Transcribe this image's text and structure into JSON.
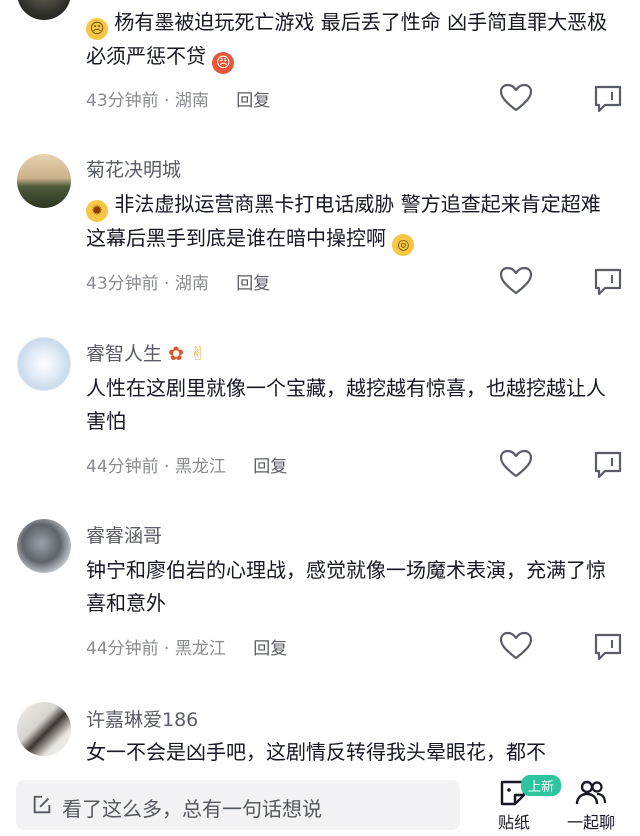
{
  "comments": [
    {
      "name": "",
      "text": "杨有墨被迫玩死亡游戏 最后丢了性命 凶手简直罪大恶极 必须严惩不贷",
      "time": "43分钟前",
      "location": "湖南",
      "reply_label": "回复"
    },
    {
      "name": "菊花决明城",
      "text": "非法虚拟运营商黑卡打电话威胁 警方追查起来肯定超难 这幕后黑手到底是谁在暗中操控啊",
      "time": "43分钟前",
      "location": "湖南",
      "reply_label": "回复"
    },
    {
      "name": "睿智人生",
      "text": "人性在这剧里就像一个宝藏，越挖越有惊喜，也越挖越让人害怕",
      "time": "44分钟前",
      "location": "黑龙江",
      "reply_label": "回复"
    },
    {
      "name": "睿睿涵哥",
      "text": "钟宁和廖伯岩的心理战，感觉就像一场魔术表演，充满了惊喜和意外",
      "time": "44分钟前",
      "location": "黑龙江",
      "reply_label": "回复"
    },
    {
      "name": "许嘉琳爱186",
      "text": "女一不会是凶手吧，这剧情反转得我头晕眼花，都不",
      "time": "",
      "location": "",
      "reply_label": ""
    }
  ],
  "meta_separator": "·",
  "bottom_bar": {
    "input_placeholder": "看了这么多，总有一句话想说",
    "sticker_label": "贴纸",
    "sticker_badge": "上新",
    "chat_label": "一起聊"
  },
  "icons": {
    "comment_1_emoji_start": "worried-face-icon",
    "comment_1_emoji_end": "angry-face-icon",
    "comment_2_emoji_start": "exploding-head-icon",
    "comment_2_emoji_end": "monocle-face-icon",
    "comment_3_name_emoji_1": "maple-leaf-icon",
    "comment_3_name_emoji_2": "victory-hand-icon",
    "like": "heart-outline-icon",
    "dislike": "dislike-icon",
    "edit": "edit-icon",
    "sticker": "sticker-icon",
    "chat": "people-icon"
  },
  "colors": {
    "text": "#161823",
    "secondary": "#8a8b91",
    "name": "#5b5d66",
    "input_bg": "#f2f2f4",
    "badge": "#2ec4a0"
  }
}
